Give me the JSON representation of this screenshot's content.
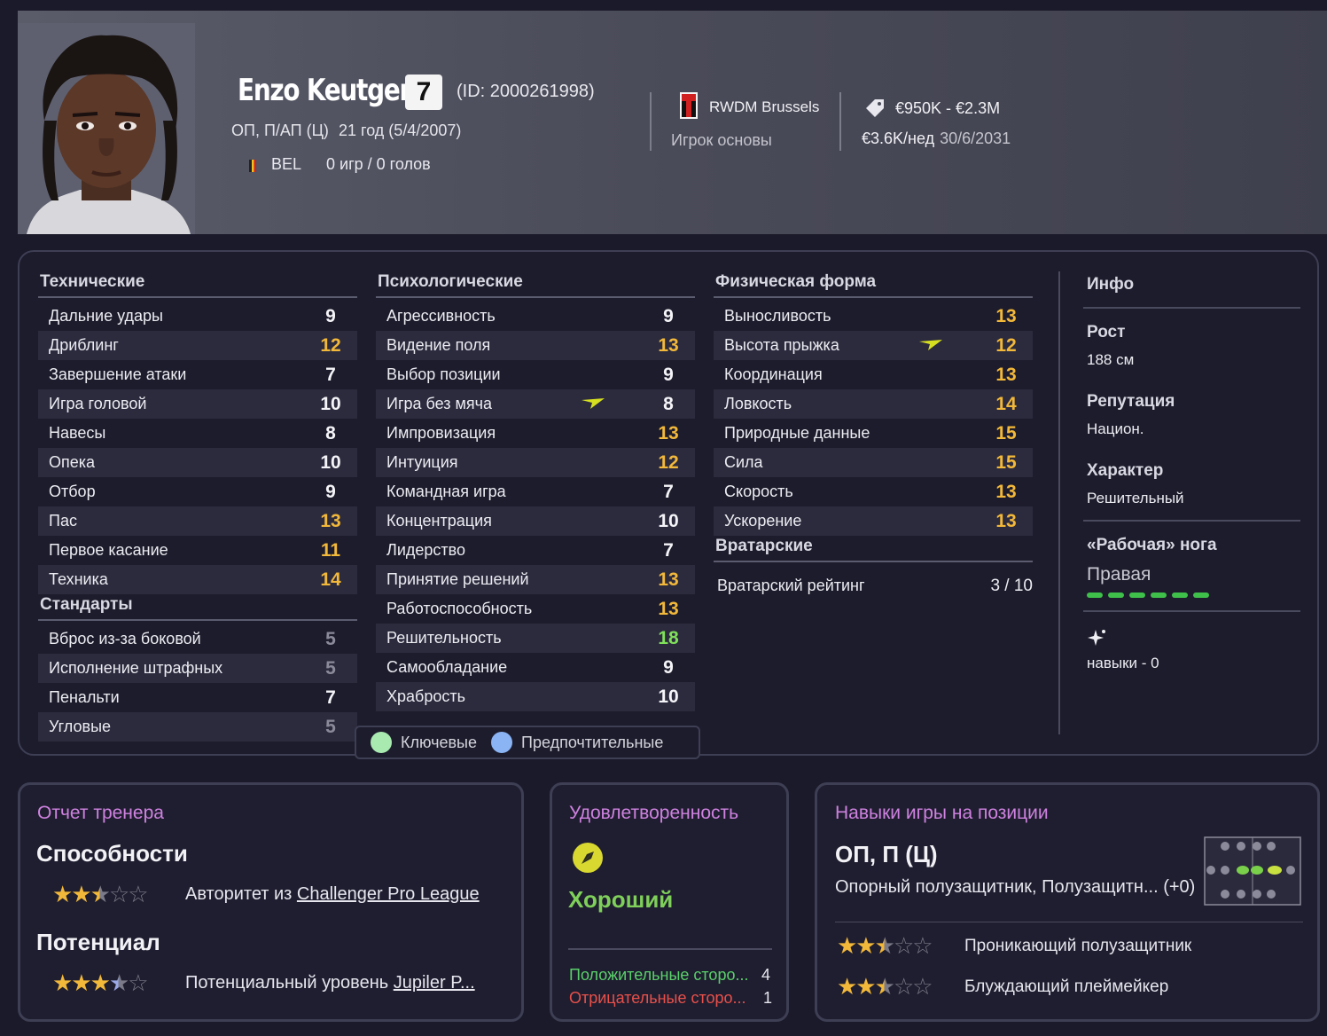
{
  "player": {
    "name": "Enzo Keutgen",
    "number": "7",
    "id": "(ID: 2000261998)",
    "positions": "ОП, П/АП (Ц)",
    "age": "21 год (5/4/2007)",
    "nationality": "BEL",
    "apps": "0 игр / 0 голов",
    "club": "RWDM Brussels",
    "squad_role": "Игрок основы",
    "value": "€950K - €2.3M",
    "wage": "€3.6K/нед",
    "contract_end": "30/6/2031"
  },
  "technical": {
    "title": "Технические",
    "rows": [
      {
        "label": "Дальние удары",
        "value": "9"
      },
      {
        "label": "Дриблинг",
        "value": "12"
      },
      {
        "label": "Завершение атаки",
        "value": "7"
      },
      {
        "label": "Игра головой",
        "value": "10"
      },
      {
        "label": "Навесы",
        "value": "8"
      },
      {
        "label": "Опека",
        "value": "10"
      },
      {
        "label": "Отбор",
        "value": "9"
      },
      {
        "label": "Пас",
        "value": "13"
      },
      {
        "label": "Первое касание",
        "value": "11"
      },
      {
        "label": "Техника",
        "value": "14"
      }
    ]
  },
  "set_pieces": {
    "title": "Стандарты",
    "rows": [
      {
        "label": "Вброс из-за боковой",
        "value": "5"
      },
      {
        "label": "Исполнение штрафных",
        "value": "5"
      },
      {
        "label": "Пенальти",
        "value": "7"
      },
      {
        "label": "Угловые",
        "value": "5"
      }
    ]
  },
  "mental": {
    "title": "Психологические",
    "rows": [
      {
        "label": "Агрессивность",
        "value": "9"
      },
      {
        "label": "Видение поля",
        "value": "13"
      },
      {
        "label": "Выбор позиции",
        "value": "9"
      },
      {
        "label": "Игра без мяча",
        "value": "8"
      },
      {
        "label": "Импровизация",
        "value": "13"
      },
      {
        "label": "Интуиция",
        "value": "12"
      },
      {
        "label": "Командная игра",
        "value": "7"
      },
      {
        "label": "Концентрация",
        "value": "10"
      },
      {
        "label": "Лидерство",
        "value": "7"
      },
      {
        "label": "Принятие решений",
        "value": "13"
      },
      {
        "label": "Работоспособность",
        "value": "13"
      },
      {
        "label": "Решительность",
        "value": "18"
      },
      {
        "label": "Самообладание",
        "value": "9"
      },
      {
        "label": "Храбрость",
        "value": "10"
      }
    ]
  },
  "physical": {
    "title": "Физическая форма",
    "rows": [
      {
        "label": "Выносливость",
        "value": "13"
      },
      {
        "label": "Высота прыжка",
        "value": "12"
      },
      {
        "label": "Координация",
        "value": "13"
      },
      {
        "label": "Ловкость",
        "value": "14"
      },
      {
        "label": "Природные данные",
        "value": "15"
      },
      {
        "label": "Сила",
        "value": "15"
      },
      {
        "label": "Скорость",
        "value": "13"
      },
      {
        "label": "Ускорение",
        "value": "13"
      }
    ]
  },
  "goalkeeping": {
    "title": "Вратарские",
    "label": "Вратарский рейтинг",
    "value": "3 / 10"
  },
  "legend": {
    "key": "Ключевые",
    "preferred": "Предпочтительные",
    "key_color": "#a8eab0",
    "preferred_color": "#8ab4f4"
  },
  "info": {
    "title": "Инфо",
    "height_label": "Рост",
    "height": "188 см",
    "reputation_label": "Репутация",
    "reputation": "Национ.",
    "personality_label": "Характер",
    "personality": "Решительный",
    "foot_label": "«Рабочая» нога",
    "foot": "Правая",
    "skills": "навыки - 0"
  },
  "coach_report": {
    "title": "Отчет тренера",
    "ability_label": "Способности",
    "ability_stars": 2.5,
    "ability_prefix": "Авторитет из ",
    "ability_league": "Challenger Pro League",
    "potential_label": "Потенциал",
    "potential_stars": 3.5,
    "potential_prefix": "Потенциальный уровень ",
    "potential_league": "Jupiler P..."
  },
  "happiness": {
    "title": "Удовлетворенность",
    "status": "Хороший",
    "positive_label": "Положительные сторо...",
    "positive_count": "4",
    "negative_label": "Отрицательные сторо...",
    "negative_count": "1"
  },
  "position_skills": {
    "title": "Навыки игры на позиции",
    "positions": "ОП, П (Ц)",
    "roles": "Опорный полузащитник, Полузащитн...",
    "modifier": "(+0)",
    "role1": "Проникающий полузащитник",
    "role1_stars": 2.5,
    "role2": "Блуждающий плеймейкер",
    "role2_stars": 2.5
  },
  "colors": {
    "accent_title": "#cf82e0",
    "attr_orange": "#f2b83a",
    "attr_green": "#7fe05a",
    "happy_green": "#7fd05a",
    "negative_red": "#e8504a"
  }
}
